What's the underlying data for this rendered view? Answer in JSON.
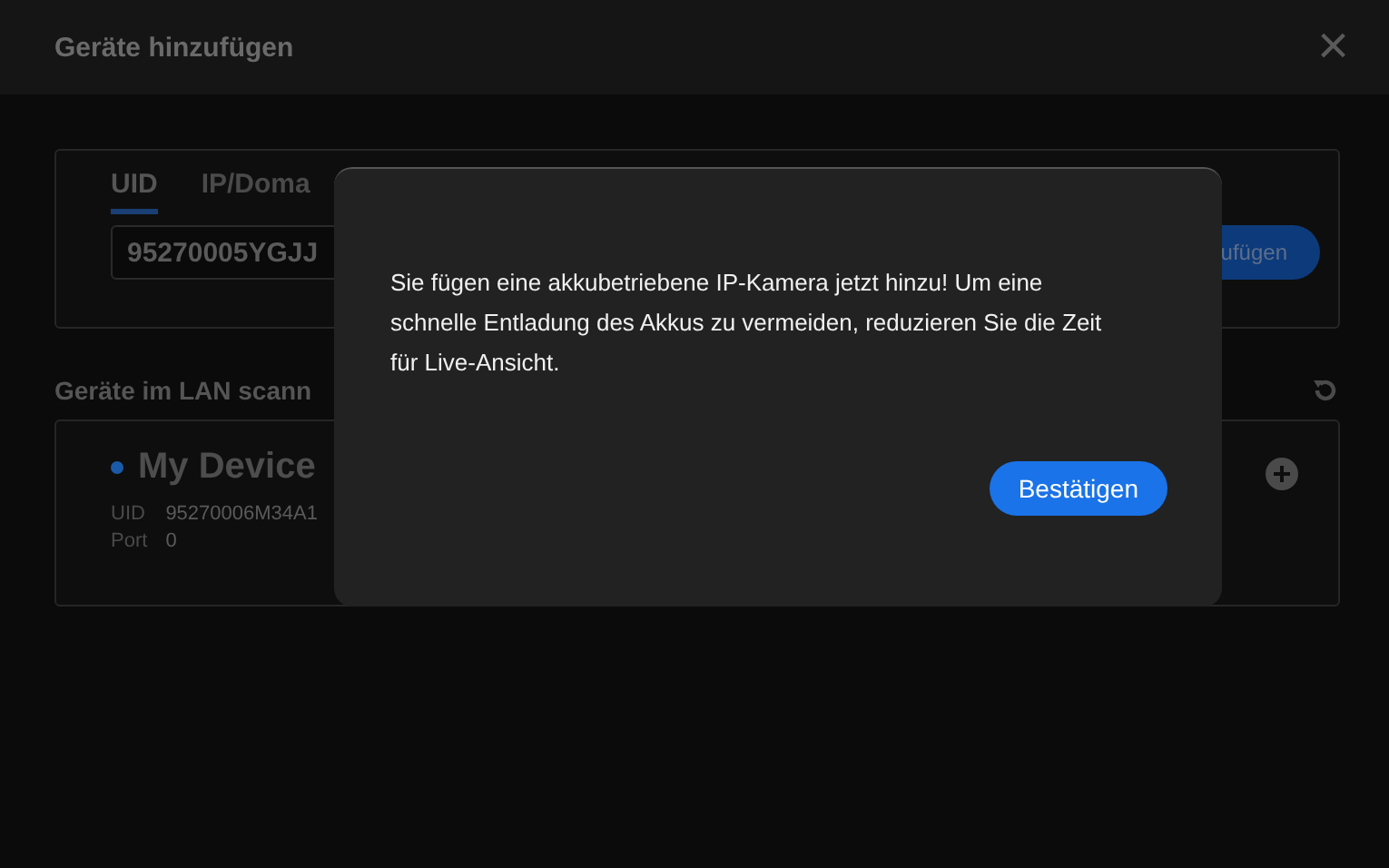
{
  "window": {
    "title": "Geräte hinzufügen",
    "close": "×"
  },
  "add_panel": {
    "tabs": [
      {
        "label": "UID",
        "selected": true
      },
      {
        "label": "IP/Doma",
        "selected": false
      }
    ],
    "uid_field": {
      "value": "95270005YGJJ"
    },
    "add_button": "ufügen"
  },
  "lan_scan": {
    "heading": "Geräte im LAN scann",
    "devices": [
      {
        "name": "My Device",
        "color": "#1a5aa8",
        "fields": [
          {
            "label": "UID",
            "value": "95270006M34A1"
          },
          {
            "label": "Port",
            "value": "0"
          }
        ]
      }
    ]
  },
  "dialog": {
    "message": "Sie fügen eine akkubetriebene IP-Kamera jetzt hinzu! Um eine schnelle Entladung des Akkus zu vermeiden, reduzieren Sie die Zeit für Live-Ansicht.",
    "confirm": "Bestätigen"
  }
}
